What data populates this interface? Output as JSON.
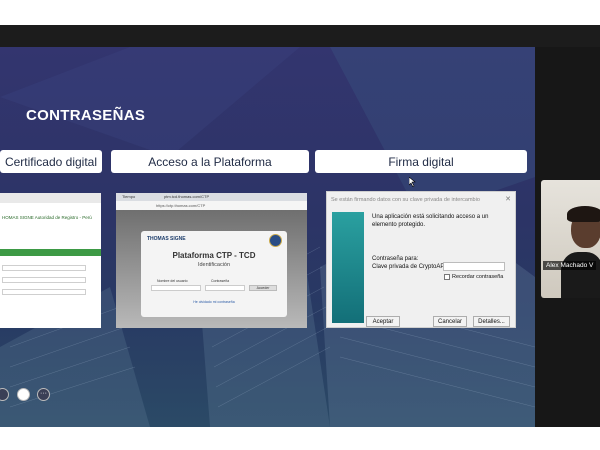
{
  "slide": {
    "title": "CONTRASEÑAS",
    "columns": [
      "Certificado digital",
      "Acceso a la Plataforma",
      "Firma digital"
    ]
  },
  "cert_panel": {
    "line1": "HOMAS SIGNE Autoridad de Registro - Perú"
  },
  "browser_panel": {
    "tab1": "Tiempo",
    "tab2": "ptm.tcd.thomas.com/CTP",
    "url": "https://ctp.thomas.com/CTP",
    "brand": "THOMAS SIGNE",
    "platform_title": "Plataforma CTP - TCD",
    "platform_subtitle": "Identificación",
    "user_label": "Nombre del usuario",
    "password_label": "Contraseña",
    "login_button": "Acceder",
    "forgot_link": "He olvidado mi contraseña"
  },
  "dialog": {
    "title": "Se están firmando datos con su clave privada de intercambio",
    "message": "Una aplicación está solicitando acceso a un elemento protegido.",
    "password_for": "Contraseña para:",
    "key_label": "Clave privada de CryptoAP",
    "remember": "Recordar contraseña",
    "accept": "Aceptar",
    "cancel": "Cancelar",
    "details": "Detalles..."
  },
  "participant": {
    "name": "Alex Machado V"
  },
  "colors": {
    "slide_top": "#33356f",
    "slide_bottom": "#2b4a66",
    "green_bar": "#3d9a45",
    "dialog_graphic": "#1d8a8a"
  }
}
